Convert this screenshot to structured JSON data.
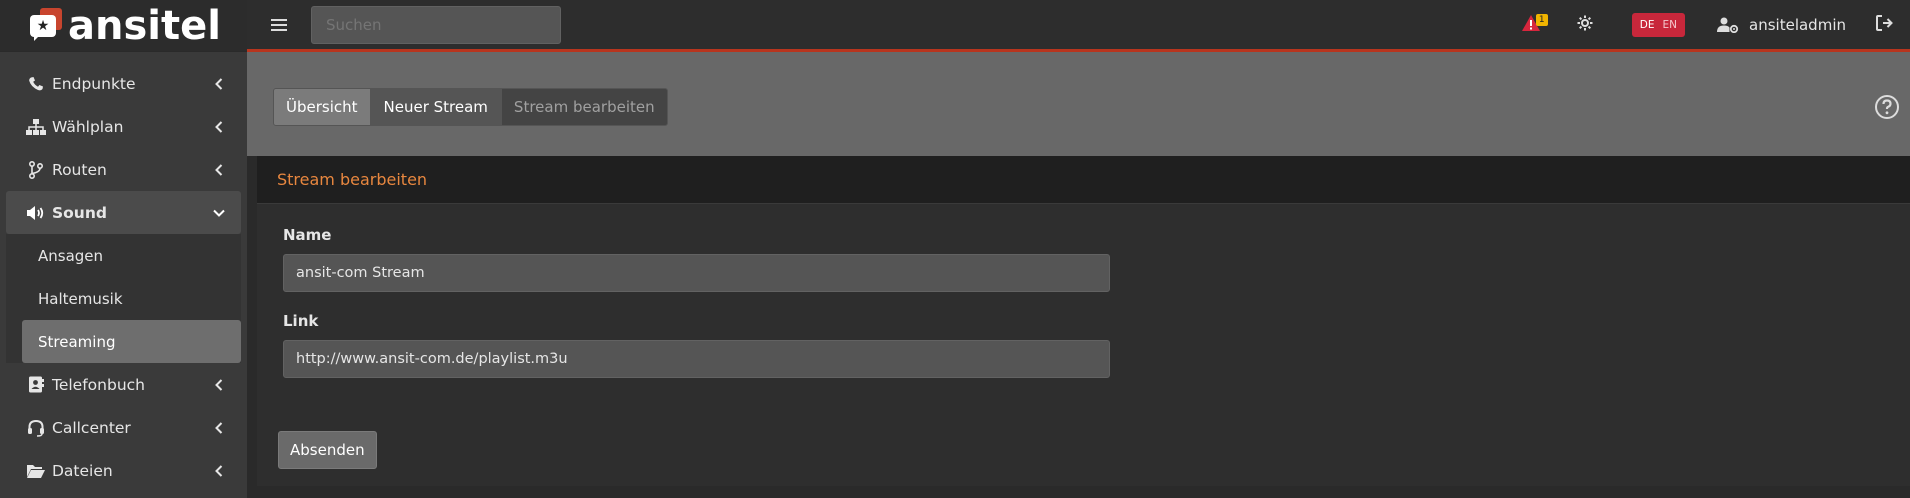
{
  "brand": {
    "name": "ansitel",
    "logo_icon": "speech-bubble-star-icon"
  },
  "topbar": {
    "menu_icon": "hamburger-icon",
    "search_placeholder": "Suchen",
    "alert_count": "1",
    "lang_active": "DE",
    "lang_inactive": "EN",
    "username": "ansiteladmin",
    "colors": {
      "accent_line": "#b8351e",
      "lang_bg": "#c8273b",
      "badge": "#f0b400"
    }
  },
  "sidebar": {
    "items": [
      {
        "label": "Endpunkte",
        "icon": "phone-icon"
      },
      {
        "label": "Wählplan",
        "icon": "sitemap-icon"
      },
      {
        "label": "Routen",
        "icon": "route-icon"
      },
      {
        "label": "Sound",
        "icon": "volume-icon",
        "expanded": true,
        "children": [
          {
            "label": "Ansagen"
          },
          {
            "label": "Haltemusik"
          },
          {
            "label": "Streaming",
            "current": true
          }
        ]
      },
      {
        "label": "Telefonbuch",
        "icon": "address-book-icon"
      },
      {
        "label": "Callcenter",
        "icon": "headset-icon"
      },
      {
        "label": "Dateien",
        "icon": "folder-open-icon"
      }
    ]
  },
  "tabs": [
    {
      "label": "Übersicht"
    },
    {
      "label": "Neuer Stream"
    },
    {
      "label": "Stream bearbeiten"
    }
  ],
  "card": {
    "title": "Stream bearbeiten",
    "title_color": "#e8873f",
    "fields": [
      {
        "label": "Name",
        "value": "ansit-com Stream"
      },
      {
        "label": "Link",
        "value": "http://www.ansit-com.de/playlist.m3u"
      }
    ],
    "submit_label": "Absenden"
  }
}
